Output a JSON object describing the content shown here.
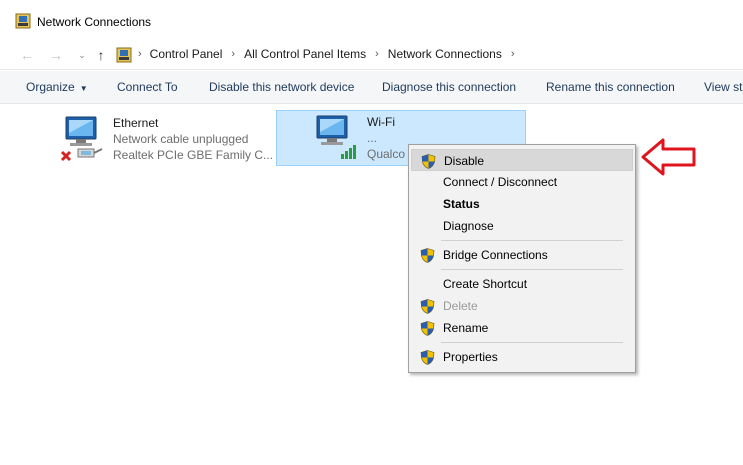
{
  "window": {
    "title": "Network Connections"
  },
  "address": {
    "crumbs": [
      "Control Panel",
      "All Control Panel Items",
      "Network Connections"
    ]
  },
  "toolbar": {
    "organize": "Organize",
    "connect_to": "Connect To",
    "disable_device": "Disable this network device",
    "diagnose": "Diagnose this connection",
    "rename": "Rename this connection",
    "view_status": "View sta"
  },
  "adapters": [
    {
      "name": "Ethernet",
      "status": "Network cable unplugged",
      "device": "Realtek PCIe GBE Family C..."
    },
    {
      "name": "Wi-Fi",
      "status": "...",
      "device": "Qualco"
    }
  ],
  "context_menu": {
    "items": [
      {
        "label": "Disable",
        "shield": true,
        "state": "highlighted"
      },
      {
        "label": "Connect / Disconnect",
        "shield": false
      },
      {
        "label": "Status",
        "shield": false,
        "bold": true
      },
      {
        "label": "Diagnose",
        "shield": false
      },
      {
        "label": "Bridge Connections",
        "shield": true
      },
      {
        "label": "Create Shortcut",
        "shield": false
      },
      {
        "label": "Delete",
        "shield": true,
        "disabled": true
      },
      {
        "label": "Rename",
        "shield": true
      },
      {
        "label": "Properties",
        "shield": true
      }
    ]
  },
  "colors": {
    "selection": "#cce8ff",
    "toolbar_bg": "#f5f6f7",
    "toolbar_text": "#1e395b",
    "annotation_arrow": "#e0141e"
  }
}
